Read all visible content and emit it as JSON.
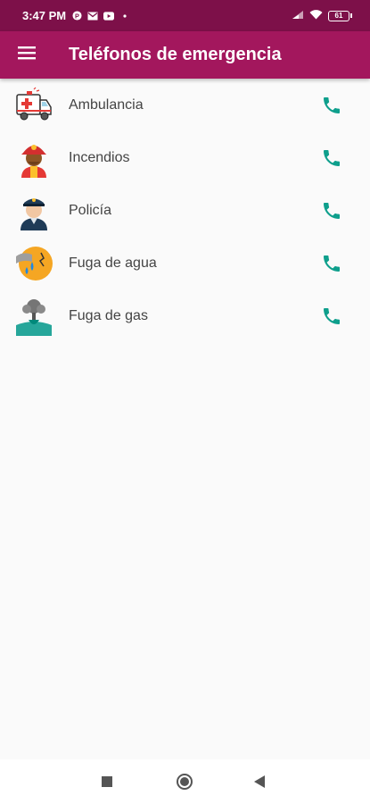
{
  "status_bar": {
    "time": "3:47 PM",
    "battery": "61",
    "icons": [
      "pinterest-icon",
      "gmail-icon",
      "youtube-icon",
      "dot-icon",
      "signal-icon",
      "wifi-icon",
      "battery-icon"
    ]
  },
  "app_bar": {
    "title": "Teléfonos de emergencia",
    "menu_icon": "hamburger-menu-icon"
  },
  "contacts": [
    {
      "label": "Ambulancia",
      "icon": "ambulance-icon"
    },
    {
      "label": "Incendios",
      "icon": "firefighter-icon"
    },
    {
      "label": "Policía",
      "icon": "police-icon"
    },
    {
      "label": "Fuga de agua",
      "icon": "water-leak-icon"
    },
    {
      "label": "Fuga de gas",
      "icon": "gas-leak-icon"
    }
  ],
  "call_icon": "phone-icon",
  "colors": {
    "status_bar": "#7d1049",
    "app_bar": "#a3175d",
    "call_icon": "#0e9f8c",
    "background": "#fafafa"
  },
  "nav_bar": {
    "buttons": [
      "recents-square-icon",
      "home-circle-icon",
      "back-triangle-icon"
    ]
  }
}
